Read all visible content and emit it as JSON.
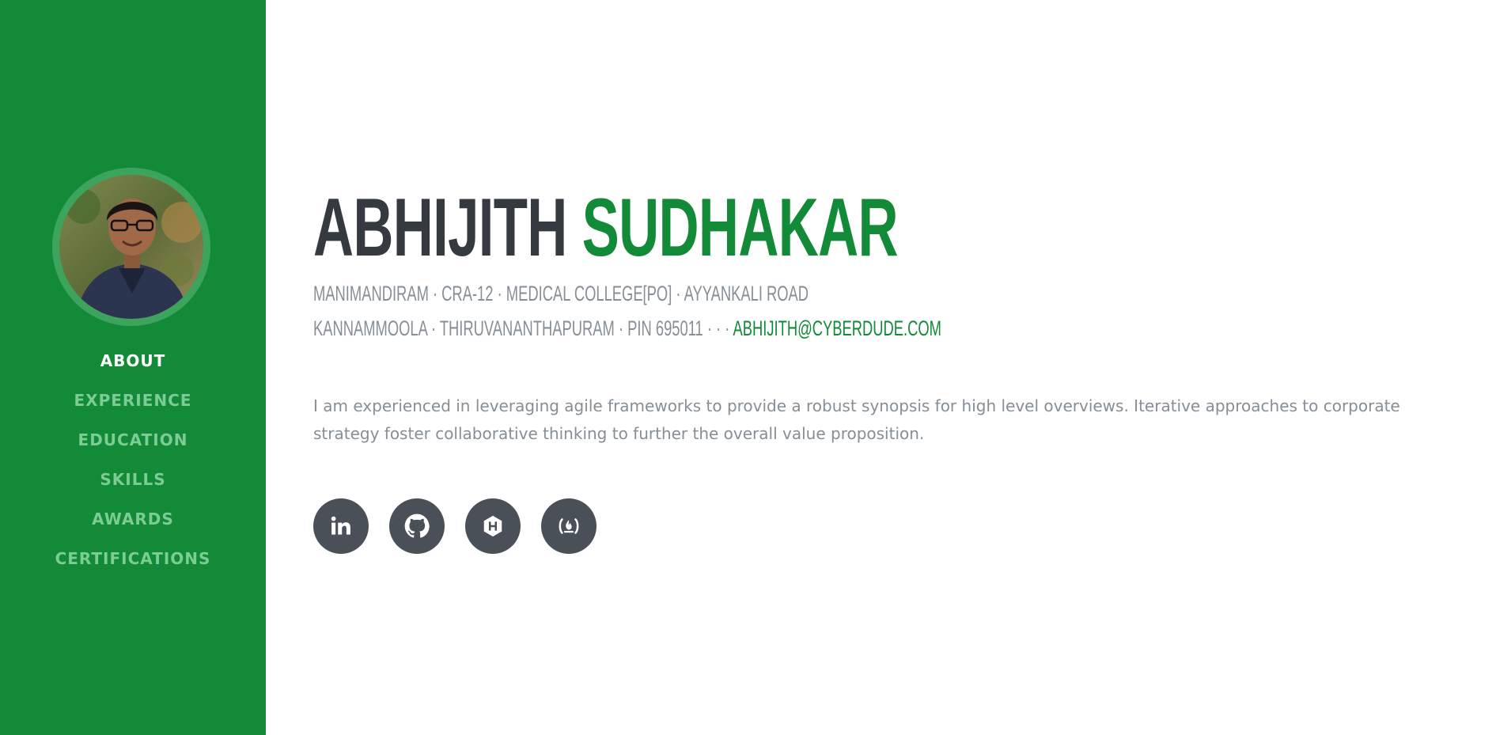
{
  "profile": {
    "first_name": "ABHIJITH",
    "last_name": "SUDHAKAR",
    "address_line1": "MANIMANDIRAM · CRA-12 · MEDICAL COLLEGE[PO] · AYYANKALI ROAD",
    "address_line2": "KANNAMMOOLA · THIRUVANANTHAPURAM · PIN 695011 · · ·",
    "email": "ABHIJITH@CYBERDUDE.COM",
    "summary": "I am experienced in leveraging agile frameworks to provide a robust synopsis for high level overviews. Iterative approaches to corporate strategy foster collaborative thinking to further the overall value proposition."
  },
  "nav": {
    "active": "ABOUT",
    "items": [
      "ABOUT",
      "EXPERIENCE",
      "EDUCATION",
      "SKILLS",
      "AWARDS",
      "CERTIFICATIONS"
    ]
  },
  "social": [
    {
      "icon": "linkedin-icon"
    },
    {
      "icon": "github-icon"
    },
    {
      "icon": "hackerrank-icon"
    },
    {
      "icon": "freecodecamp-icon"
    }
  ],
  "colors": {
    "primary": "#128a37",
    "sidebar_link": "#7ccc95",
    "text_dark": "#343a40",
    "text_muted": "#868e96",
    "social_bg": "#495057"
  }
}
